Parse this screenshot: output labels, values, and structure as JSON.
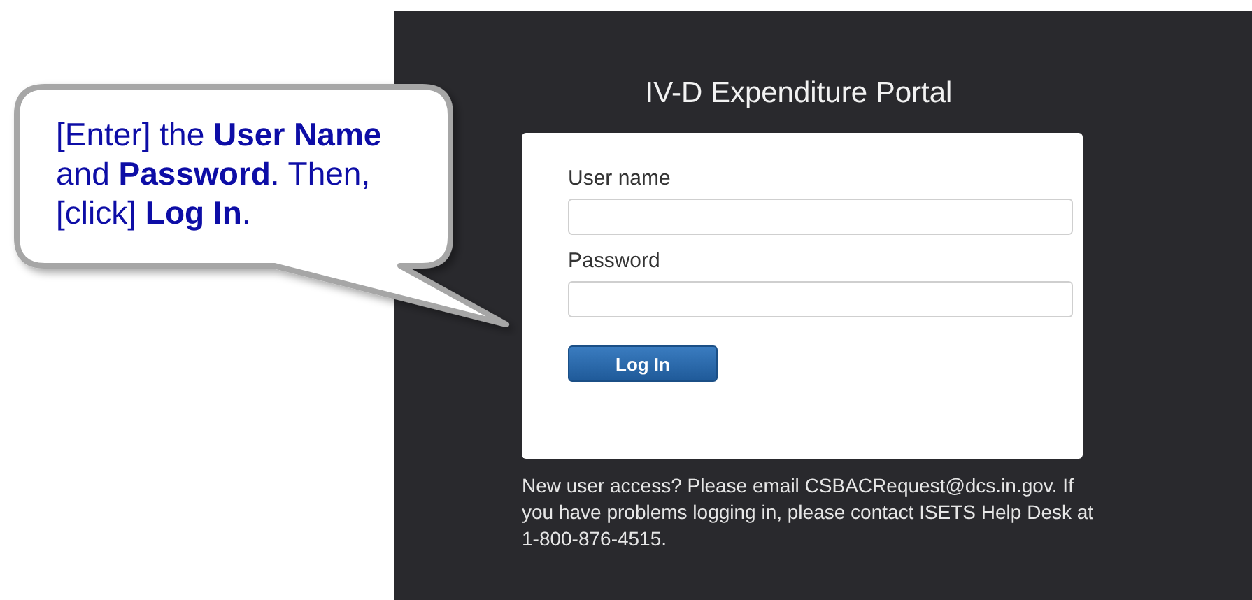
{
  "callout": {
    "text": "[Enter] the **User Name** and **Password**. Then, [click] **Log In**."
  },
  "portal": {
    "title": "IV-D Expenditure Portal",
    "fields": [
      {
        "label": "User name"
      },
      {
        "label": "Password"
      }
    ],
    "login_button": "Log In",
    "footer": "New user access? Please email CSBACRequest@dcs.in.gov. If you have problems logging in, please contact ISETS Help Desk at 1-800-876-4515."
  }
}
